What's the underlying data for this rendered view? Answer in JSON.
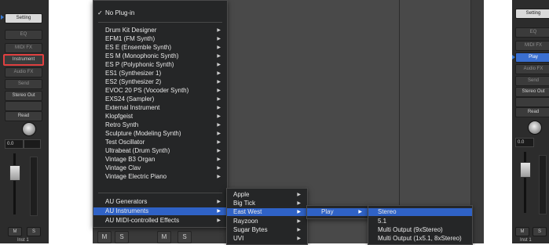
{
  "left_strip": {
    "setting": "Setting",
    "eq": "EQ",
    "midi_fx": "MIDI FX",
    "instrument": "Instrument",
    "audio_fx": "Audio FX",
    "send": "Send",
    "output": "Stereo Out",
    "automation": "Read",
    "pan_value": "0.0",
    "mute": "M",
    "solo": "S",
    "name": "Inst 1"
  },
  "right_strip": {
    "setting": "Setting",
    "eq": "EQ",
    "midi_fx": "MIDI FX",
    "instrument": "Play",
    "audio_fx": "Audio FX",
    "send": "Send",
    "output": "Stereo Out",
    "automation": "Read",
    "pan_value": "0.0",
    "mute": "M",
    "solo": "S",
    "name": "Inst 1"
  },
  "mixer_bottom": {
    "mute": "M",
    "solo": "S"
  },
  "main_menu": {
    "checkmark": "✓",
    "no_plugin": "No Plug-in",
    "items": [
      {
        "label": "Drum Kit Designer"
      },
      {
        "label": "EFM1  (FM Synth)"
      },
      {
        "label": "ES E  (Ensemble Synth)"
      },
      {
        "label": "ES M  (Monophonic Synth)"
      },
      {
        "label": "ES P  (Polyphonic Synth)"
      },
      {
        "label": "ES1  (Synthesizer 1)"
      },
      {
        "label": "ES2  (Synthesizer 2)"
      },
      {
        "label": "EVOC 20 PS  (Vocoder Synth)"
      },
      {
        "label": "EXS24  (Sampler)"
      },
      {
        "label": "External Instrument"
      },
      {
        "label": "Klopfgeist"
      },
      {
        "label": "Retro Synth"
      },
      {
        "label": "Sculpture  (Modeling Synth)"
      },
      {
        "label": "Test Oscillator"
      },
      {
        "label": "Ultrabeat  (Drum Synth)"
      },
      {
        "label": "Vintage B3 Organ"
      },
      {
        "label": "Vintage Clav"
      },
      {
        "label": "Vintage Electric Piano"
      }
    ],
    "groups": [
      {
        "label": "AU Generators"
      },
      {
        "label": "AU Instruments"
      },
      {
        "label": "AU MIDI-controlled Effects"
      }
    ],
    "submenu_arrow": "▶"
  },
  "au_menu": {
    "items": [
      {
        "label": "Apple"
      },
      {
        "label": "Big Tick"
      },
      {
        "label": "East West"
      },
      {
        "label": "Rayzoon"
      },
      {
        "label": "Sugar Bytes"
      },
      {
        "label": "UVI"
      }
    ]
  },
  "eastwest_menu": {
    "items": [
      {
        "label": "Play"
      }
    ]
  },
  "play_menu": {
    "items": [
      {
        "label": "Stereo"
      },
      {
        "label": "5.1"
      },
      {
        "label": "Multi Output (9xStereo)"
      },
      {
        "label": "Multi Output (1x5.1, 8xStereo)"
      }
    ]
  },
  "colors": {
    "highlight": "#2f62c6",
    "menu_bg": "#252627",
    "strip_bg": "#2c2c2c",
    "instrument_slot_outline": "#e04040",
    "selection_arrow": "#3a7bd5"
  }
}
